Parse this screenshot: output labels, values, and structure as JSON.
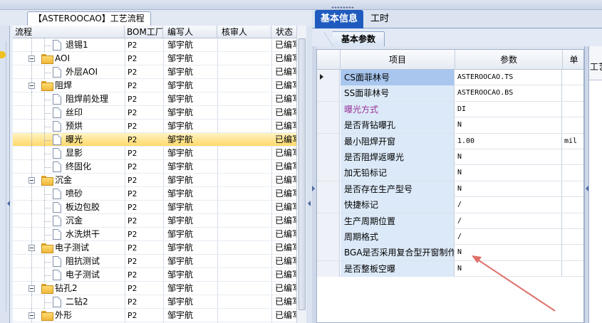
{
  "left_panel": {
    "tab_title": "【ASTEROOCAO】工艺流程",
    "columns": [
      "流程",
      "BOM工厂",
      "编写人",
      "核审人",
      "状态"
    ],
    "rows": [
      {
        "level": 2,
        "type": "doc",
        "name": "退锡1",
        "bom": "P2",
        "author": "邹宇航",
        "reviewer": "",
        "status": "已编写"
      },
      {
        "level": 1,
        "type": "folder",
        "name": "AOI",
        "bom": "P2",
        "author": "邹宇航",
        "reviewer": "",
        "status": "已编写"
      },
      {
        "level": 2,
        "type": "doc",
        "name": "外层AOI",
        "bom": "P2",
        "author": "邹宇航",
        "reviewer": "",
        "status": "已编写"
      },
      {
        "level": 1,
        "type": "folder",
        "name": "阻焊",
        "bom": "P2",
        "author": "邹宇航",
        "reviewer": "",
        "status": "已编写"
      },
      {
        "level": 2,
        "type": "doc",
        "name": "阻焊前处理",
        "bom": "P2",
        "author": "邹宇航",
        "reviewer": "",
        "status": "已编写"
      },
      {
        "level": 2,
        "type": "doc",
        "name": "丝印",
        "bom": "P2",
        "author": "邹宇航",
        "reviewer": "",
        "status": "已编写"
      },
      {
        "level": 2,
        "type": "doc",
        "name": "预烘",
        "bom": "P2",
        "author": "邹宇航",
        "reviewer": "",
        "status": "已编写"
      },
      {
        "level": 2,
        "type": "doc",
        "name": "曝光",
        "bom": "P2",
        "author": "邹宇航",
        "reviewer": "",
        "status": "已编写",
        "selected": true
      },
      {
        "level": 2,
        "type": "doc",
        "name": "显影",
        "bom": "P2",
        "author": "邹宇航",
        "reviewer": "",
        "status": "已编写"
      },
      {
        "level": 2,
        "type": "doc",
        "name": "终固化",
        "bom": "P2",
        "author": "邹宇航",
        "reviewer": "",
        "status": "已编写"
      },
      {
        "level": 1,
        "type": "folder",
        "name": "沉金",
        "bom": "P2",
        "author": "邹宇航",
        "reviewer": "",
        "status": "已编写"
      },
      {
        "level": 2,
        "type": "doc",
        "name": "喷砂",
        "bom": "P2",
        "author": "邹宇航",
        "reviewer": "",
        "status": "已编写"
      },
      {
        "level": 2,
        "type": "doc",
        "name": "板边包胶",
        "bom": "P2",
        "author": "邹宇航",
        "reviewer": "",
        "status": "已编写"
      },
      {
        "level": 2,
        "type": "doc",
        "name": "沉金",
        "bom": "P2",
        "author": "邹宇航",
        "reviewer": "",
        "status": "已编写"
      },
      {
        "level": 2,
        "type": "doc",
        "name": "水洗烘干",
        "bom": "P2",
        "author": "邹宇航",
        "reviewer": "",
        "status": "已编写"
      },
      {
        "level": 1,
        "type": "folder",
        "name": "电子测试",
        "bom": "P2",
        "author": "邹宇航",
        "reviewer": "",
        "status": "已编写"
      },
      {
        "level": 2,
        "type": "doc",
        "name": "阻抗测试",
        "bom": "P2",
        "author": "邹宇航",
        "reviewer": "",
        "status": "已编写"
      },
      {
        "level": 2,
        "type": "doc",
        "name": "电子测试",
        "bom": "P2",
        "author": "邹宇航",
        "reviewer": "",
        "status": "已编写"
      },
      {
        "level": 1,
        "type": "folder",
        "name": "钻孔2",
        "bom": "P2",
        "author": "邹宇航",
        "reviewer": "",
        "status": "已编写"
      },
      {
        "level": 2,
        "type": "doc",
        "name": "二钻2",
        "bom": "P2",
        "author": "邹宇航",
        "reviewer": "",
        "status": "已编写"
      },
      {
        "level": 1,
        "type": "folder",
        "name": "外形",
        "bom": "P2",
        "author": "邹宇航",
        "reviewer": "",
        "status": "已编写"
      }
    ]
  },
  "right_panel": {
    "tabs": [
      "基本信息",
      "工时"
    ],
    "sub_tab": "基本参数",
    "columns": [
      "项目",
      "参数",
      "单"
    ],
    "far_label": "工艺",
    "rows": [
      {
        "item": "CS面菲林号",
        "value": "ASTEROOCAO.TS",
        "unit": "",
        "current": true
      },
      {
        "item": "SS面菲林号",
        "value": "ASTEROOCAO.BS",
        "unit": ""
      },
      {
        "item": "曝光方式",
        "value": "DI",
        "unit": "",
        "highlight": true
      },
      {
        "item": "是否背钻曝孔",
        "value": "N",
        "unit": ""
      },
      {
        "item": "最小阻焊开窗",
        "value": "1.00",
        "unit": "mil"
      },
      {
        "item": "是否阻焊返曝光",
        "value": "N",
        "unit": ""
      },
      {
        "item": "加无铅标记",
        "value": "N",
        "unit": ""
      },
      {
        "item": "是否存在生产型号",
        "value": "N",
        "unit": ""
      },
      {
        "item": "快捷标记",
        "value": "/",
        "unit": ""
      },
      {
        "item": "生产周期位置",
        "value": "/",
        "unit": ""
      },
      {
        "item": "周期格式",
        "value": "/",
        "unit": ""
      },
      {
        "item": "BGA是否采用复合型开窗制作",
        "value": "N",
        "unit": ""
      },
      {
        "item": "是否整板空曝",
        "value": "N",
        "unit": ""
      }
    ]
  },
  "colors": {
    "active_tab": "#1f5bbf",
    "selected_row": "#ffd96b",
    "highlight_item_text": "#993399",
    "annotation_arrow": "#e0706a"
  }
}
